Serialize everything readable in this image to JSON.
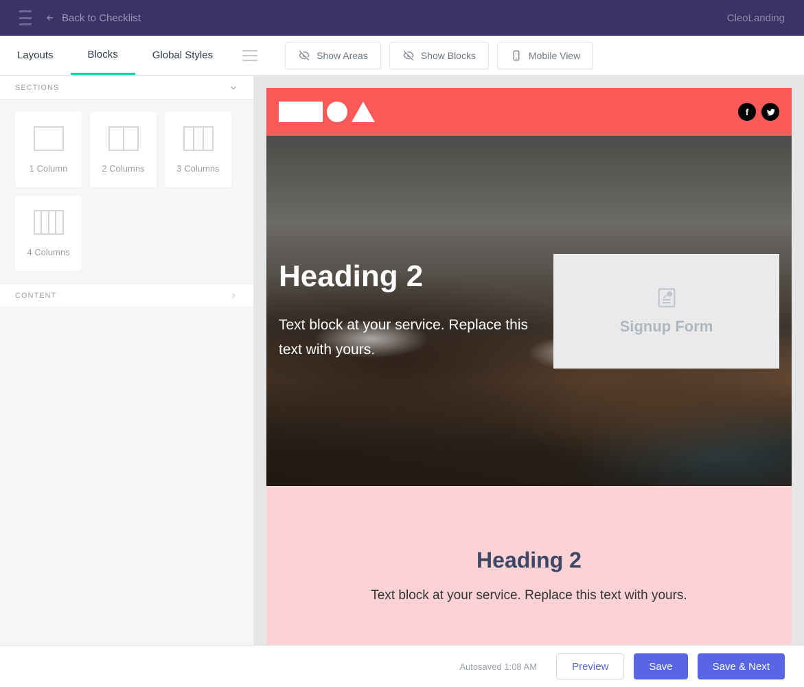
{
  "header": {
    "back_label": "Back to Checklist",
    "brand": "CleoLanding"
  },
  "toolbar": {
    "tabs": [
      {
        "label": "Layouts"
      },
      {
        "label": "Blocks"
      },
      {
        "label": "Global Styles"
      }
    ],
    "active_tab_index": 1,
    "view_buttons": {
      "show_areas": "Show Areas",
      "show_blocks": "Show Blocks",
      "mobile_view": "Mobile View"
    }
  },
  "sidebar": {
    "sections_label": "SECTIONS",
    "content_label": "CONTENT",
    "column_blocks": [
      {
        "label": "1 Column",
        "cols": 1
      },
      {
        "label": "2 Columns",
        "cols": 2
      },
      {
        "label": "3 Columns",
        "cols": 3
      },
      {
        "label": "4 Columns",
        "cols": 4
      }
    ]
  },
  "canvas": {
    "hero": {
      "heading": "Heading 2",
      "body": "Text block at your service. Replace this text with yours.",
      "signup_label": "Signup Form"
    },
    "section2": {
      "heading": "Heading 2",
      "body": "Text block at your service. Replace this text with yours."
    },
    "header_color": "#fc5a58"
  },
  "footer": {
    "autosaved": "Autosaved 1:08 AM",
    "preview": "Preview",
    "save": "Save",
    "save_next": "Save & Next"
  }
}
